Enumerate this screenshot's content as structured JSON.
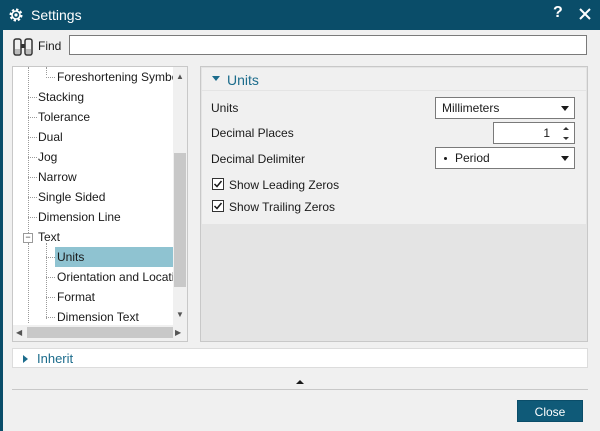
{
  "window": {
    "title": "Settings",
    "help_label": "?",
    "colors": {
      "titlebar": "#0a4d69",
      "accent": "#1c6c8c",
      "selection": "#8fc3d1"
    }
  },
  "find": {
    "label": "Find",
    "value": "",
    "placeholder": ""
  },
  "tree": {
    "items": [
      {
        "label": "Foreshortening Symbol",
        "level": 2
      },
      {
        "label": "Stacking",
        "level": 1
      },
      {
        "label": "Tolerance",
        "level": 1
      },
      {
        "label": "Dual",
        "level": 1
      },
      {
        "label": "Jog",
        "level": 1
      },
      {
        "label": "Narrow",
        "level": 1
      },
      {
        "label": "Single Sided",
        "level": 1
      },
      {
        "label": "Dimension Line",
        "level": 1
      },
      {
        "label": "Text",
        "level": 1,
        "expanded": true
      },
      {
        "label": "Units",
        "level": 2,
        "selected": true
      },
      {
        "label": "Orientation and Location",
        "level": 2
      },
      {
        "label": "Format",
        "level": 2
      },
      {
        "label": "Dimension Text",
        "level": 2
      }
    ]
  },
  "section": {
    "title": "Units",
    "fields": {
      "units": {
        "label": "Units",
        "value": "Millimeters"
      },
      "decimal_places": {
        "label": "Decimal Places",
        "value": "1"
      },
      "decimal_delimiter": {
        "label": "Decimal Delimiter",
        "value": "Period"
      }
    },
    "checkboxes": {
      "leading_zeros": {
        "label": "Show Leading Zeros",
        "checked": true
      },
      "trailing_zeros": {
        "label": "Show Trailing Zeros",
        "checked": true
      }
    }
  },
  "inherit": {
    "label": "Inherit"
  },
  "footer": {
    "close_label": "Close"
  }
}
